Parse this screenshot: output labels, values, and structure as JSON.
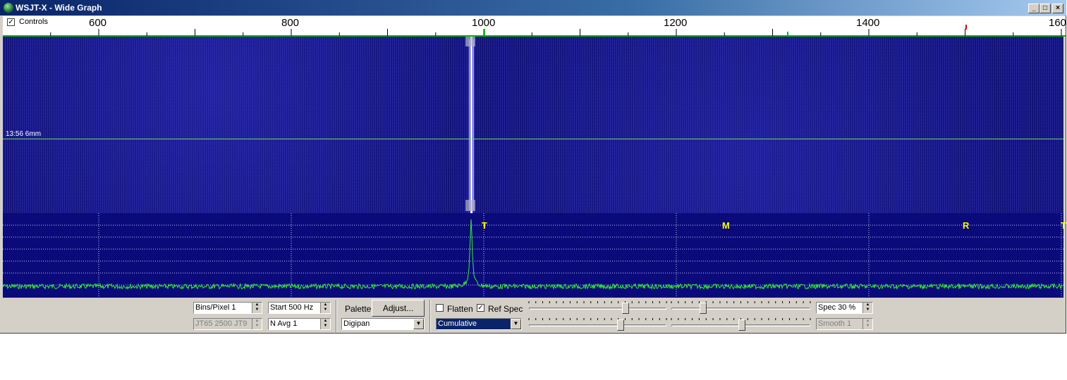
{
  "window": {
    "title": "WSJT-X - Wide Graph",
    "minimize_label": "_",
    "maximize_label": "□",
    "close_label": "×"
  },
  "scale": {
    "controls_checked": true,
    "controls_label": "Controls",
    "freq_labels": [
      "600",
      "800",
      "1000",
      "1200",
      "1400",
      "160"
    ]
  },
  "waterfall": {
    "timestamp": "13:56   6mm",
    "signal_freq_hz": 985
  },
  "spectrum": {
    "markers": [
      "T",
      "M",
      "R"
    ]
  },
  "controls": {
    "bins_per_pixel": "Bins/Pixel  1",
    "modes": "JT65   2500   JT9",
    "start": "Start 500 Hz",
    "navg": "N Avg 1",
    "palette_label": "Palette",
    "adjust_label": "Adjust...",
    "palette_value": "Digipan",
    "flatten_label": "Flatten",
    "flatten_checked": false,
    "refspec_label": "Ref Spec",
    "refspec_checked": true,
    "spectrum_type": "Cumulative",
    "spec_pct": "Spec 30 %",
    "smooth": "Smooth  1"
  },
  "colors": {
    "waterfall": "#16168a",
    "spectrum_bg": "#0a0a7a",
    "trace": "#33ee33",
    "marker": "#ffff00",
    "title_gradient_start": "#0a246a"
  }
}
